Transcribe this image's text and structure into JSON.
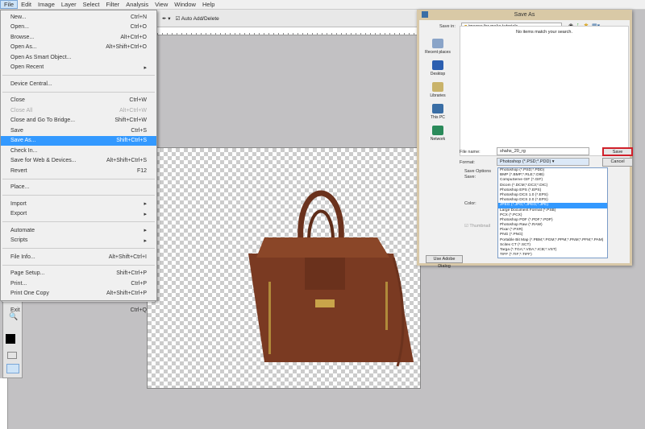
{
  "menubar": [
    "File",
    "Edit",
    "Image",
    "Layer",
    "Select",
    "Filter",
    "Analysis",
    "View",
    "Window",
    "Help"
  ],
  "options_bar": {
    "auto_add_delete": "Auto Add/Delete"
  },
  "file_menu": [
    {
      "label": "New...",
      "shortcut": "Ctrl+N"
    },
    {
      "label": "Open...",
      "shortcut": "Ctrl+O"
    },
    {
      "label": "Browse...",
      "shortcut": "Alt+Ctrl+O"
    },
    {
      "label": "Open As...",
      "shortcut": "Alt+Shift+Ctrl+O"
    },
    {
      "label": "Open As Smart Object...",
      "shortcut": ""
    },
    {
      "label": "Open Recent",
      "shortcut": "",
      "submenu": true
    },
    {
      "sep": true
    },
    {
      "label": "Device Central...",
      "shortcut": ""
    },
    {
      "sep": true
    },
    {
      "label": "Close",
      "shortcut": "Ctrl+W"
    },
    {
      "label": "Close All",
      "shortcut": "Alt+Ctrl+W",
      "disabled": true
    },
    {
      "label": "Close and Go To Bridge...",
      "shortcut": "Shift+Ctrl+W"
    },
    {
      "label": "Save",
      "shortcut": "Ctrl+S"
    },
    {
      "label": "Save As...",
      "shortcut": "Shift+Ctrl+S",
      "selected": true
    },
    {
      "label": "Check In...",
      "shortcut": ""
    },
    {
      "label": "Save for Web & Devices...",
      "shortcut": "Alt+Shift+Ctrl+S"
    },
    {
      "label": "Revert",
      "shortcut": "F12"
    },
    {
      "sep": true
    },
    {
      "label": "Place...",
      "shortcut": ""
    },
    {
      "sep": true
    },
    {
      "label": "Import",
      "shortcut": "",
      "submenu": true
    },
    {
      "label": "Export",
      "shortcut": "",
      "submenu": true
    },
    {
      "sep": true
    },
    {
      "label": "Automate",
      "shortcut": "",
      "submenu": true
    },
    {
      "label": "Scripts",
      "shortcut": "",
      "submenu": true
    },
    {
      "sep": true
    },
    {
      "label": "File Info...",
      "shortcut": "Alt+Shift+Ctrl+I"
    },
    {
      "sep": true
    },
    {
      "label": "Page Setup...",
      "shortcut": "Shift+Ctrl+P"
    },
    {
      "label": "Print...",
      "shortcut": "Ctrl+P"
    },
    {
      "label": "Print One Copy",
      "shortcut": "Alt+Shift+Ctrl+P"
    },
    {
      "sep": true
    },
    {
      "label": "Exit",
      "shortcut": "Ctrl+Q"
    }
  ],
  "dialog": {
    "title": "Save As",
    "save_in_label": "Save in:",
    "save_in_value": "images for make tutorials",
    "empty_message": "No items match your search.",
    "places": [
      "Recent places",
      "Desktop",
      "Libraries",
      "This PC",
      "Network"
    ],
    "file_name_label": "File name:",
    "file_name_value": "shahs_20_rg",
    "format_label": "Format:",
    "format_value": "Photoshop (*.PSD;*.PDD)",
    "save_button": "Save",
    "cancel_button": "Cancel",
    "save_options_label": "Save Options",
    "save_label": "Save:",
    "color_label": "Color:",
    "thumbnail_label": "Thumbnail",
    "use_adobe_dialog": "Use Adobe Dialog",
    "formats": [
      "Photoshop (*.PSD;*.PDD)",
      "BMP (*.BMP;*.RLE;*.DIB)",
      "CompuServe GIF (*.GIF)",
      "Dicom (*.DCM;*.DC3;*.DIC)",
      "Photoshop EPS (*.EPS)",
      "Photoshop DCS 1.0 (*.EPS)",
      "Photoshop DCS 2.0 (*.EPS)",
      "JPEG (*.JPG;*.JPEG;*.JPE)",
      "Large Document Format (*.PSB)",
      "PCX (*.PCX)",
      "Photoshop PDF (*.PDF;*.PDP)",
      "Photoshop Raw (*.RAW)",
      "Pixar (*.PXR)",
      "PNG (*.PNG)",
      "Portable Bit Map (*.PBM;*.PGM;*.PPM;*.PNM;*.PFM;*.PAM)",
      "Scitex CT (*.SCT)",
      "Targa (*.TGA;*.VDA;*.ICB;*.VST)",
      "TIFF (*.TIF;*.TIFF)"
    ],
    "selected_format_index": 7
  },
  "colors": {
    "highlight": "#3399ff",
    "save_border": "#d0202a",
    "bag": "#7a3a22"
  }
}
